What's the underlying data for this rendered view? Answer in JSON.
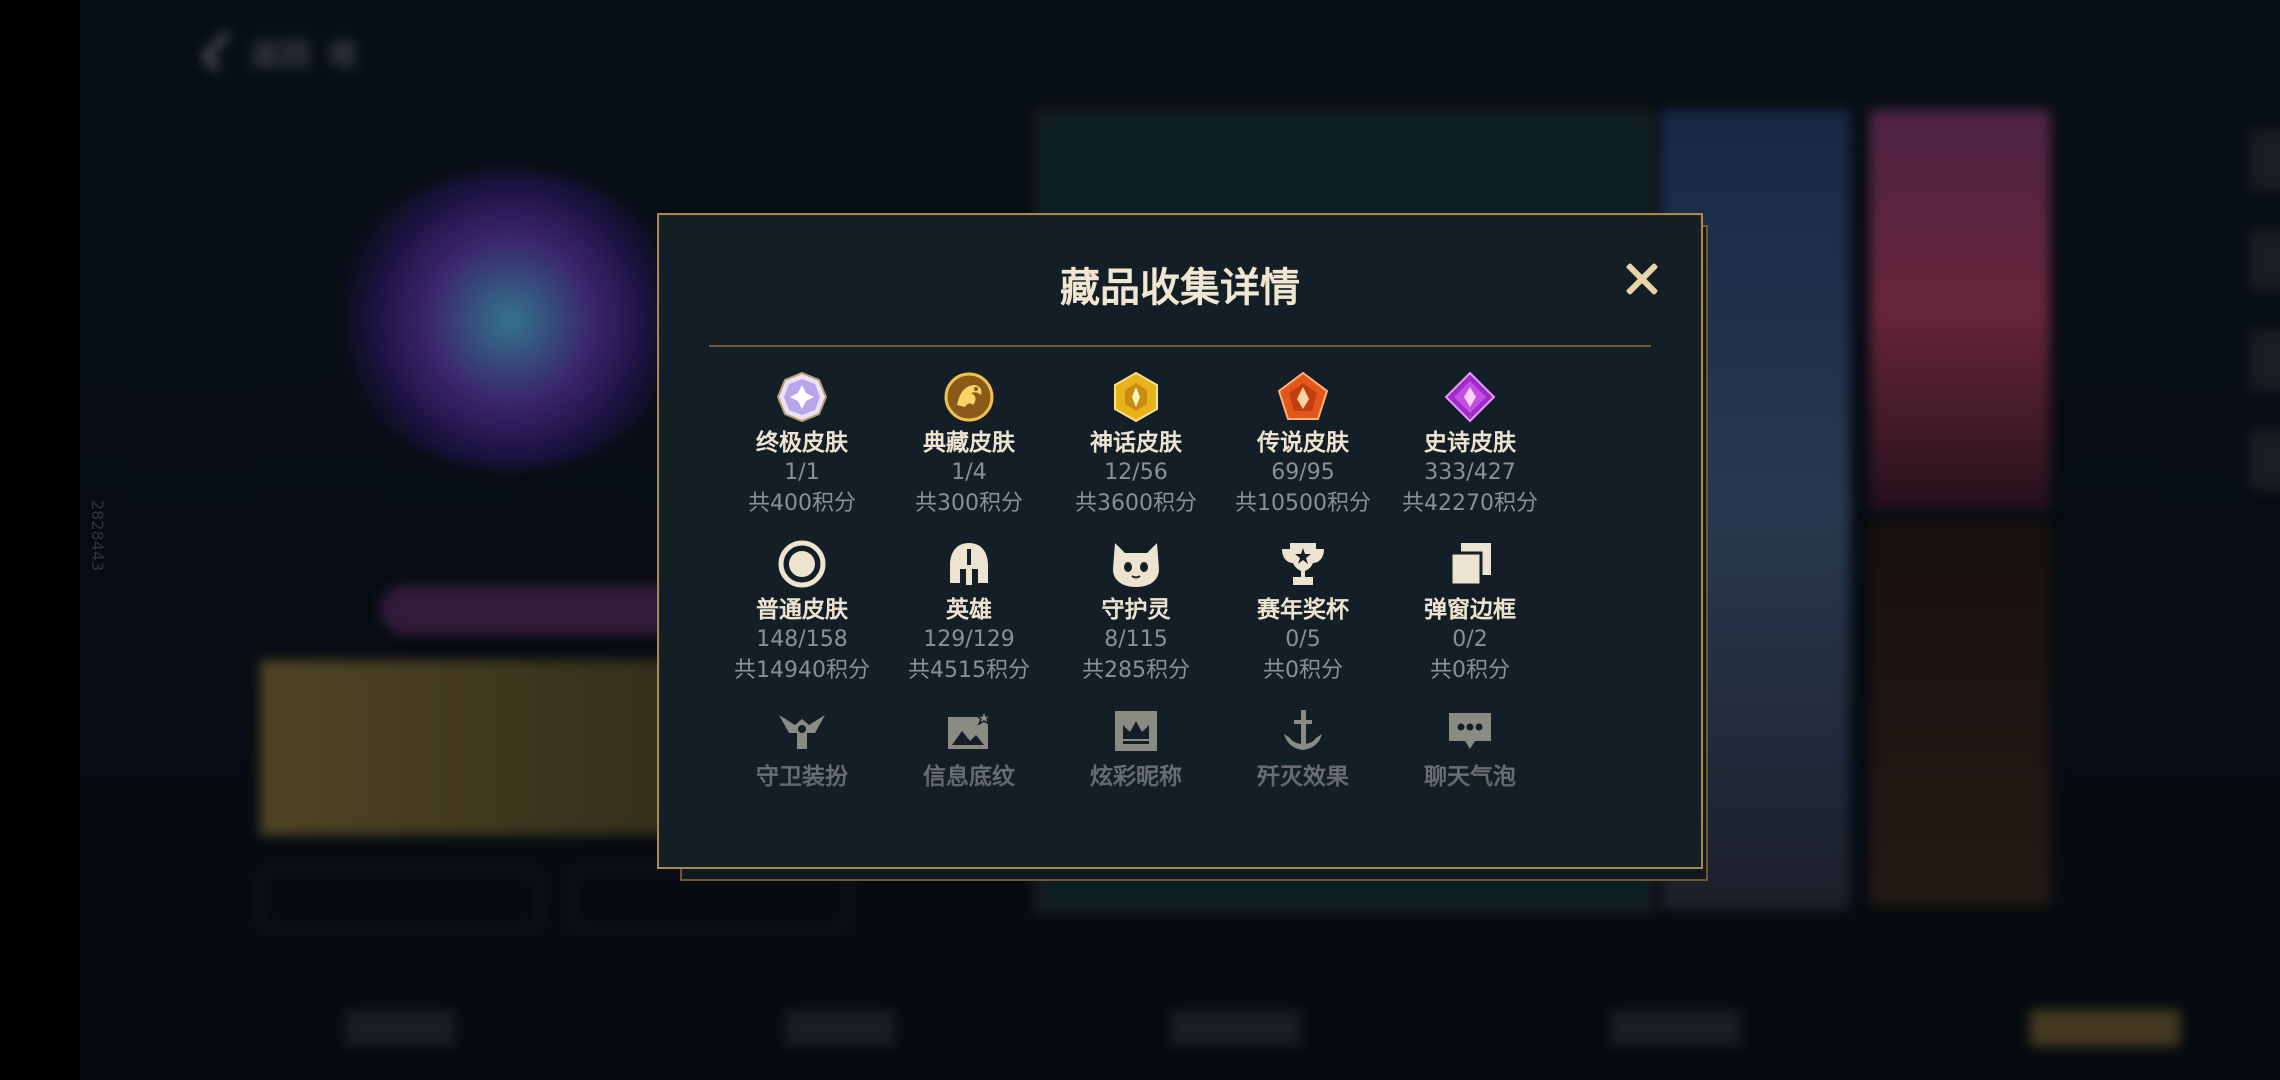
{
  "header": {
    "back_label": "返回",
    "tab_label": "收"
  },
  "side_id": "2828443",
  "modal": {
    "title": "藏品收集详情",
    "items": [
      {
        "name": "终极皮肤",
        "count": "1/1",
        "points": "共400积分",
        "icon": "ultimate-skin-gem-icon"
      },
      {
        "name": "典藏皮肤",
        "count": "1/4",
        "points": "共300积分",
        "icon": "prestige-dragon-icon"
      },
      {
        "name": "神话皮肤",
        "count": "12/56",
        "points": "共3600积分",
        "icon": "mythic-gem-icon"
      },
      {
        "name": "传说皮肤",
        "count": "69/95",
        "points": "共10500积分",
        "icon": "legendary-gem-icon"
      },
      {
        "name": "史诗皮肤",
        "count": "333/427",
        "points": "共42270积分",
        "icon": "epic-gem-icon"
      },
      {
        "name": "普通皮肤",
        "count": "148/158",
        "points": "共14940积分",
        "icon": "standard-skin-ring-icon"
      },
      {
        "name": "英雄",
        "count": "129/129",
        "points": "共4515积分",
        "icon": "champion-helmet-icon"
      },
      {
        "name": "守护灵",
        "count": "8/115",
        "points": "共285积分",
        "icon": "companion-creature-icon"
      },
      {
        "name": "赛年奖杯",
        "count": "0/5",
        "points": "共0积分",
        "icon": "trophy-icon"
      },
      {
        "name": "弹窗边框",
        "count": "0/2",
        "points": "共0积分",
        "icon": "frame-cards-icon"
      },
      {
        "name": "守卫装扮",
        "icon": "ward-skin-icon"
      },
      {
        "name": "信息底纹",
        "icon": "banner-image-icon"
      },
      {
        "name": "炫彩昵称",
        "icon": "crown-badge-icon"
      },
      {
        "name": "歼灭效果",
        "icon": "anchor-sword-icon"
      },
      {
        "name": "聊天气泡",
        "icon": "chat-bubble-icon"
      }
    ]
  },
  "colors": {
    "modal_bg": "#141e26",
    "gold_border": "#a48a4f",
    "title_text": "#f0e6d2",
    "muted_text": "#8b9097"
  }
}
